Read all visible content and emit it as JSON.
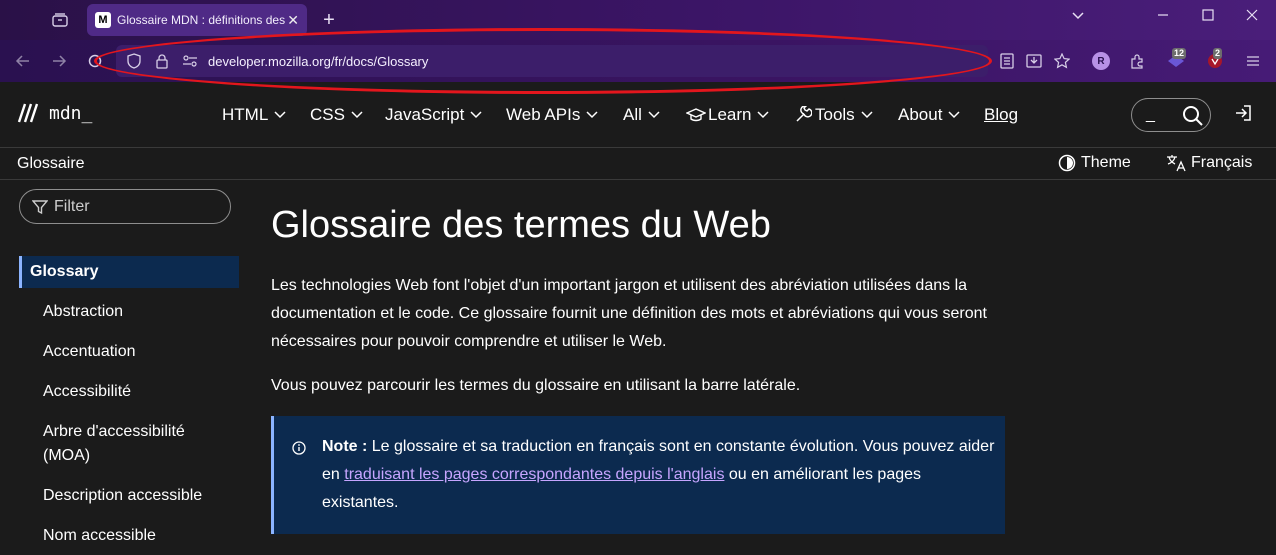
{
  "browser": {
    "tab_title": "Glossaire MDN : définitions des",
    "tab_favicon": "M",
    "tab_close": "✕",
    "new_tab": "+",
    "url": "developer.mozilla.org/fr/docs/Glossary",
    "badges": [
      "12",
      "2"
    ],
    "extension_letter": "R",
    "accent_ellipse_color": "#e3161d"
  },
  "site": {
    "logo_text": "mdn_",
    "menu": [
      "HTML",
      "CSS",
      "JavaScript",
      "Web APIs",
      "All",
      "Learn",
      "Tools",
      "About",
      "Blog"
    ],
    "search_cursor": "_",
    "breadcrumb": "Glossaire",
    "theme_label": "Theme",
    "language_label": "Français"
  },
  "sidebar": {
    "filter_placeholder": "Filter",
    "active": "Glossary",
    "items": [
      "Abstraction",
      "Accentuation",
      "Accessibilité",
      "Arbre d'accessibilité",
      "(MOA)",
      "Description accessible",
      "Nom accessible"
    ]
  },
  "main": {
    "title": "Glossaire des termes du Web",
    "para1": "Les technologies Web font l'objet d'un important jargon et utilisent des abréviation utilisées dans la documentation et le code. Ce glossaire fournit une définition des mots et abréviations qui vous seront nécessaires pour pouvoir comprendre et utiliser le Web.",
    "para2": "Vous pouvez parcourir les termes du glossaire en utilisant la barre latérale.",
    "note_label": "Note :",
    "note_text_1": "Le glossaire et sa traduction en français sont en constante évolution. Vous pouvez aider en",
    "note_link": "traduisant les pages correspondantes depuis l'anglais",
    "note_text_2": "ou en améliorant les pages existantes."
  }
}
